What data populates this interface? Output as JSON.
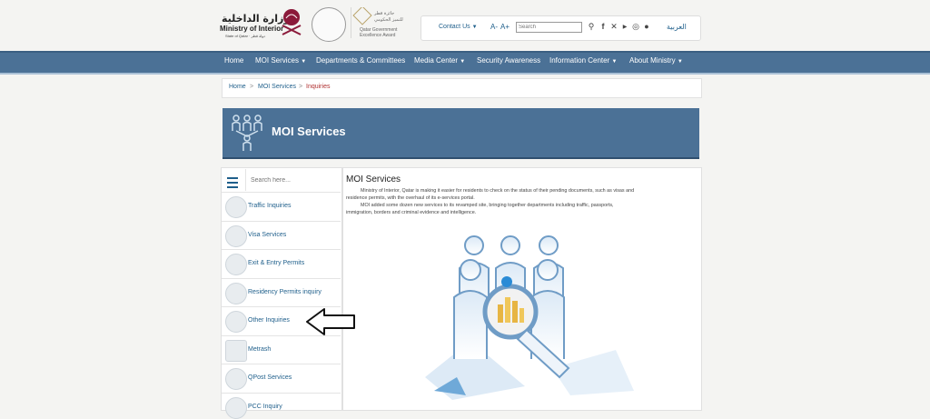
{
  "header": {
    "logo_ar": "وزارة الداخلية",
    "logo_en": "Ministry of Interior",
    "logo_sub": "State of Qatar · دولة قطر",
    "award": "Qatar Government Excellence Award",
    "contact": "Contact Us",
    "font_decrease": "A-",
    "font_increase": "A+",
    "search_placeholder": "Search",
    "language": "العربية"
  },
  "nav": {
    "items": [
      "Home",
      "MOI Services",
      "Departments & Committees",
      "Media Center",
      "Security Awareness",
      "Information Center",
      "About Ministry"
    ]
  },
  "breadcrumb": {
    "items": [
      "Home",
      "MOI Services",
      "Inquiries"
    ],
    "separator": ">"
  },
  "banner": {
    "title": "MOI Services"
  },
  "sidebar": {
    "search_placeholder": "Search here...",
    "items": [
      {
        "label": "Traffic Inquiries",
        "icon": "traffic-light-icon"
      },
      {
        "label": "Visa Services",
        "icon": "passport-icon"
      },
      {
        "label": "Exit & Entry Permits",
        "icon": "plane-icon"
      },
      {
        "label": "Residency Permits inquiry",
        "icon": "id-card-icon"
      },
      {
        "label": "Other Inquiries",
        "icon": "info-icon"
      },
      {
        "label": "Metrash",
        "icon": "phone-icon"
      },
      {
        "label": "QPost Services",
        "icon": "mail-icon"
      },
      {
        "label": "PCC Inquiry",
        "icon": "certificate-icon"
      }
    ]
  },
  "content": {
    "title": "MOI Services",
    "para1_line1": "Ministry of Interior, Qatar is making it easier for residents to check on the status of their pending documents, such as visas and",
    "para1_line2": "residence permits, with the overhaul of its e-services portal.",
    "para2_line1": "MOI added some dozen new services to its revamped site, bringing together departments including traffic, passports,",
    "para2_line2": "immigration, borders and criminal evidence and intelligence."
  },
  "colors": {
    "nav": "#4b7196",
    "banner": "#4b7196",
    "link": "#1f5f8b",
    "active_crumb": "#b03030"
  }
}
